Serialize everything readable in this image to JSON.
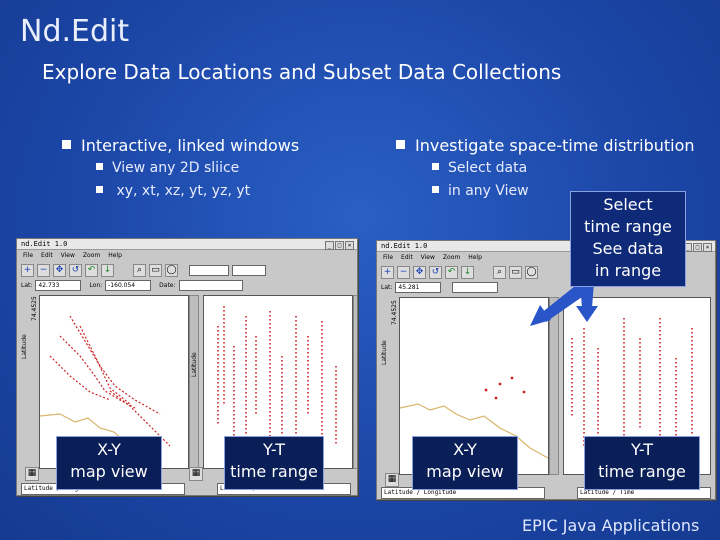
{
  "title": "Nd.Edit",
  "subtitle": "Explore Data Locations and Subset Data Collections",
  "left_bullet": "Interactive, linked windows",
  "left_subbullets": [
    "View any 2D sliice",
    " xy, xt, xz, yt, yz, yt"
  ],
  "right_bullet": "Investigate space-time distribution",
  "right_subbullets": [
    "Select data",
    "in any View"
  ],
  "callout_lines": [
    "Select",
    "time range",
    "See data",
    "in range"
  ],
  "window1": {
    "title": "nd.Edit 1.0",
    "menu": [
      "File",
      "Edit",
      "View",
      "Zoom",
      "Help"
    ],
    "lat_label": "Lat:",
    "lat_value": "42.733",
    "lon_label": "Lon:",
    "lon_value": "-160.054",
    "date_label": "Date:",
    "status": "Latitude / Longitude",
    "status2": "Latitude / Time"
  },
  "window2": {
    "title": "nd.Edit 1.0",
    "menu": [
      "File",
      "Edit",
      "View",
      "Zoom",
      "Help"
    ],
    "lat_label": "Lat:",
    "lat_value": "45.281",
    "status": "Latitude / Longitude",
    "status2": "Latitude / Time"
  },
  "plot_axis": {
    "lat": "Latitude",
    "lat_top": "74.4525",
    "lat_top2": "74.4525"
  },
  "labels": {
    "xy": [
      "X-Y",
      "map view"
    ],
    "yt": [
      "Y-T",
      "time range"
    ],
    "xy2": [
      "X-Y",
      "map view"
    ],
    "yt2": [
      "Y-T",
      "time range"
    ]
  },
  "footer": "EPIC Java Applications",
  "colors": {
    "background": "#1c47a8",
    "data_red": "#cc2222",
    "highlight": "#ffffff",
    "arrow": "#2a55c8"
  }
}
